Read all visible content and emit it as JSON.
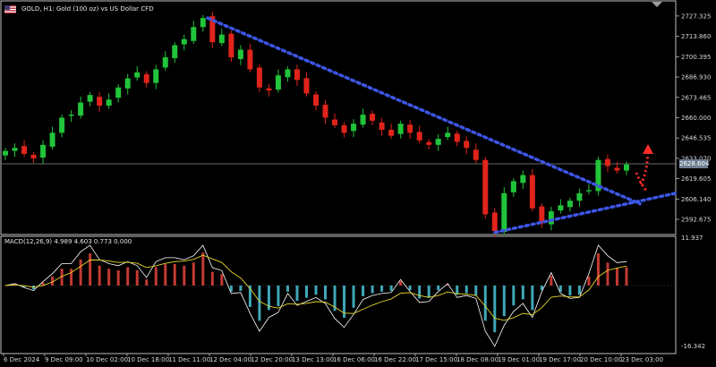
{
  "header": {
    "symbol_title": "GOLD, H1:  Gold (100 oz) vs US Dollar CFD",
    "flag_icon": "us-flag-icon",
    "menu_icon": "collapse-triangle-icon"
  },
  "price_panel": {
    "current_price": "2628.604",
    "y_ticks": [
      "2727.325",
      "2713.860",
      "2700.395",
      "2686.930",
      "2673.465",
      "2660.000",
      "2646.535",
      "2633.070",
      "2619.605",
      "2606.140",
      "2592.675"
    ],
    "y_tick_values": [
      2727.325,
      2713.86,
      2700.395,
      2686.93,
      2673.465,
      2660.0,
      2646.535,
      2633.07,
      2619.605,
      2606.14,
      2592.675
    ],
    "up_color": "#21c43a",
    "down_color": "#e0241b",
    "trendline_color": "#3d56e6",
    "arrow_color": "#ff2b2b",
    "annotations": [
      "descending-trendline",
      "ascending-support-line",
      "dotted-up-arrow"
    ]
  },
  "macd_panel": {
    "title": "MACD(12,26,9) 4.989 4.603 0.773 0.000",
    "y_ticks": [
      "11.937",
      "-16.342"
    ],
    "macd_line_color": "#ffffff",
    "signal_line_color": "#e8d629",
    "hist_pos_color": "#c23a32",
    "hist_neg_color": "#3fa7b8"
  },
  "time_axis": {
    "labels": [
      "6 Dec 2024",
      "9 Dec 09:00",
      "10 Dec 02:00",
      "10 Dec 18:00",
      "11 Dec 11:00",
      "12 Dec 04:00",
      "12 Dec 20:00",
      "13 Dec 13:00",
      "16 Dec 06:00",
      "16 Dec 22:00",
      "17 Dec 15:00",
      "18 Dec 08:00",
      "19 Dec 01:00",
      "19 Dec 17:00",
      "20 Dec 10:00",
      "23 Dec 03:00"
    ]
  },
  "chart_data": {
    "type": "candlestick",
    "symbol": "GOLD",
    "timeframe": "H1",
    "y_range": [
      2585,
      2732
    ],
    "key_points": {
      "start_close": 2638,
      "peak_high": 2726,
      "peak_time": "12 Dec 04:00",
      "pre_drop_level": 2640,
      "low": 2584,
      "low_time": "19 Dec 01:00",
      "last_close": 2628.604
    },
    "closes": [
      2638,
      2640,
      2636,
      2633,
      2642,
      2650,
      2660,
      2662,
      2670,
      2675,
      2668,
      2672,
      2680,
      2686,
      2690,
      2683,
      2692,
      2700,
      2708,
      2712,
      2720,
      2726,
      2710,
      2715,
      2700,
      2705,
      2692,
      2680,
      2678,
      2688,
      2692,
      2685,
      2676,
      2668,
      2660,
      2655,
      2650,
      2656,
      2662,
      2658,
      2652,
      2648,
      2656,
      2650,
      2645,
      2642,
      2646,
      2650,
      2644,
      2640,
      2632,
      2596,
      2585,
      2610,
      2618,
      2622,
      2600,
      2590,
      2598,
      2602,
      2605,
      2610,
      2612,
      2632,
      2628,
      2625,
      2629
    ],
    "macd_title": "MACD(12,26,9) 4.989 4.603 0.773 0.000",
    "macd_ylim": [
      -16.342,
      11.937
    ]
  }
}
